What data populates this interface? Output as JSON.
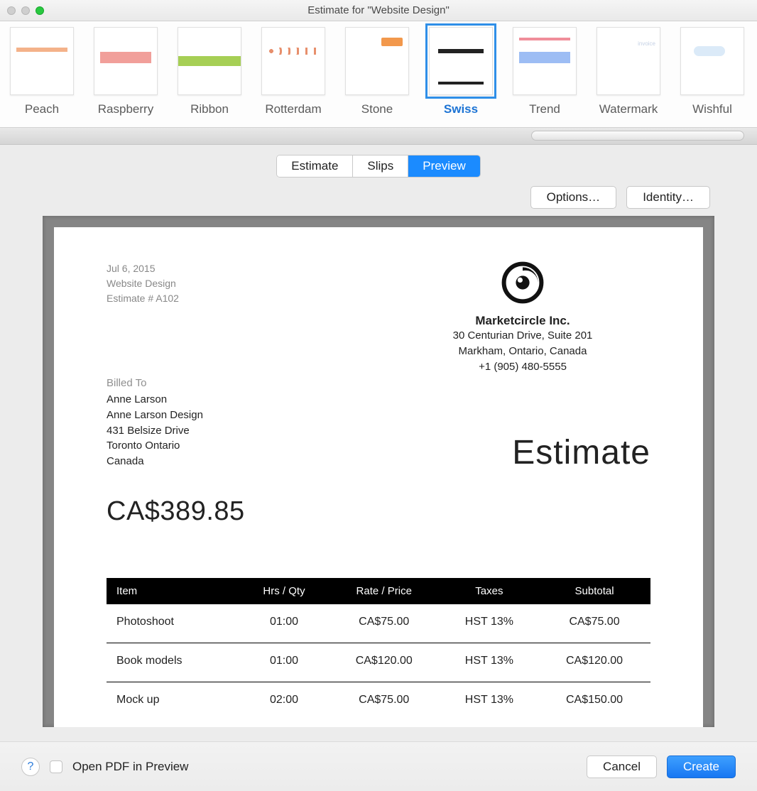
{
  "window": {
    "title": "Estimate for \"Website Design\""
  },
  "templates": [
    {
      "id": "peach",
      "label": "Peach",
      "selected": false
    },
    {
      "id": "raspberry",
      "label": "Raspberry",
      "selected": false
    },
    {
      "id": "ribbon",
      "label": "Ribbon",
      "selected": false
    },
    {
      "id": "rotterdam",
      "label": "Rotterdam",
      "selected": false
    },
    {
      "id": "stone",
      "label": "Stone",
      "selected": false
    },
    {
      "id": "swiss",
      "label": "Swiss",
      "selected": true
    },
    {
      "id": "trend",
      "label": "Trend",
      "selected": false
    },
    {
      "id": "watermark",
      "label": "Watermark",
      "selected": false
    },
    {
      "id": "wishful",
      "label": "Wishful",
      "selected": false
    }
  ],
  "tabs": {
    "estimate": "Estimate",
    "slips": "Slips",
    "preview": "Preview",
    "active": "preview"
  },
  "buttons": {
    "options": "Options…",
    "identity": "Identity…",
    "cancel": "Cancel",
    "create": "Create"
  },
  "footer": {
    "open_pdf_label": "Open PDF in Preview"
  },
  "document": {
    "date": "Jul 6, 2015",
    "project": "Website Design",
    "estimate_no": "Estimate # A102",
    "company": {
      "name": "Marketcircle Inc.",
      "line1": "30 Centurian Drive, Suite 201",
      "line2": "Markham, Ontario, Canada",
      "phone": "+1 (905) 480-5555"
    },
    "billed_to_label": "Billed To",
    "billed_to": {
      "name": "Anne Larson",
      "company": "Anne Larson Design",
      "street": "431 Belsize Drive",
      "city": "Toronto Ontario",
      "country": "Canada"
    },
    "doc_title": "Estimate",
    "total": "CA$389.85",
    "columns": {
      "item": "Item",
      "hrs": "Hrs / Qty",
      "rate": "Rate / Price",
      "taxes": "Taxes",
      "subtotal": "Subtotal"
    },
    "rows": [
      {
        "item": "Photoshoot",
        "hrs": "01:00",
        "rate": "CA$75.00",
        "taxes": "HST 13%",
        "subtotal": "CA$75.00"
      },
      {
        "item": "Book models",
        "hrs": "01:00",
        "rate": "CA$120.00",
        "taxes": "HST 13%",
        "subtotal": "CA$120.00"
      },
      {
        "item": "Mock up",
        "hrs": "02:00",
        "rate": "CA$75.00",
        "taxes": "HST 13%",
        "subtotal": "CA$150.00"
      }
    ]
  }
}
